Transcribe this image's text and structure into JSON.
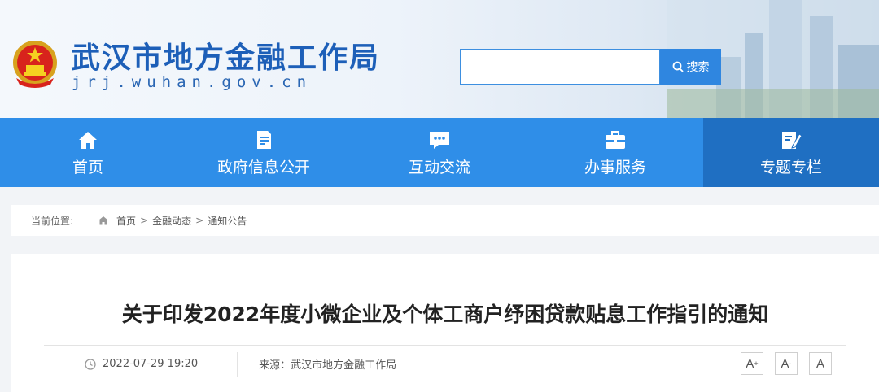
{
  "header": {
    "site_title": "武汉市地方金融工作局",
    "site_domain": "jrj.wuhan.gov.cn",
    "search": {
      "value": "",
      "button_label": "搜索"
    }
  },
  "nav": {
    "items": [
      {
        "label": "首页",
        "icon": "home-icon"
      },
      {
        "label": "政府信息公开",
        "icon": "document-icon"
      },
      {
        "label": "互动交流",
        "icon": "chat-icon"
      },
      {
        "label": "办事服务",
        "icon": "briefcase-icon"
      },
      {
        "label": "专题专栏",
        "icon": "edit-icon",
        "active": true
      }
    ]
  },
  "breadcrumb": {
    "label": "当前位置:",
    "items": [
      "首页",
      "金融动态",
      "通知公告"
    ],
    "separator": ">"
  },
  "article": {
    "title": "关于印发2022年度小微企业及个体工商户纾困贷款贴息工作指引的通知",
    "date": "2022-07-29 19:20",
    "source_label": "来源：",
    "source": "武汉市地方金融工作局",
    "font_controls": [
      "A+",
      "A-",
      "A"
    ]
  },
  "colors": {
    "nav_bg": "#2f8ee8",
    "nav_active": "#1f6fc2",
    "title_blue": "#1d5fb8",
    "search_button": "#2f86e0"
  }
}
